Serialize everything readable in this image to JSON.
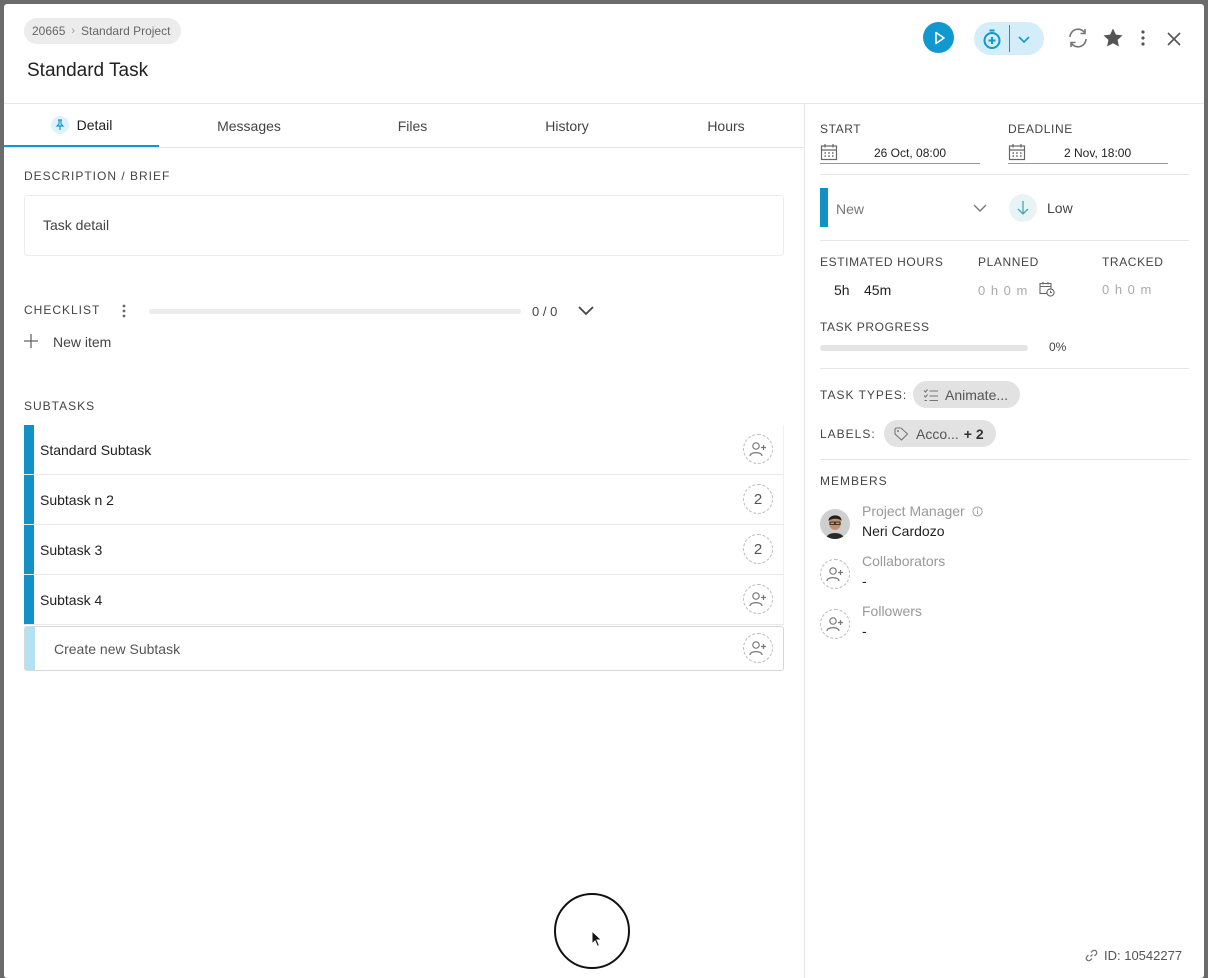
{
  "breadcrumb": {
    "project_id": "20665",
    "project_name": "Standard Project"
  },
  "task": {
    "title": "Standard Task",
    "id_label": "ID: 10542277"
  },
  "tabs": [
    {
      "label": "Detail",
      "active": true
    },
    {
      "label": "Messages"
    },
    {
      "label": "Files"
    },
    {
      "label": "History"
    },
    {
      "label": "Hours"
    }
  ],
  "description": {
    "label": "DESCRIPTION / BRIEF",
    "text": "Task detail"
  },
  "checklist": {
    "label": "CHECKLIST",
    "count": "0 / 0",
    "progress": 0,
    "new_item": "New item"
  },
  "subtasks": {
    "label": "SUBTASKS",
    "items": [
      {
        "name": "Standard Subtask",
        "assignees": ""
      },
      {
        "name": "Subtask n 2",
        "assignees": "2"
      },
      {
        "name": "Subtask 3",
        "assignees": "2"
      },
      {
        "name": "Subtask 4",
        "assignees": ""
      }
    ],
    "create_placeholder": "Create new Subtask"
  },
  "dates": {
    "start_label": "START",
    "start_value": "26 Oct, 08:00",
    "deadline_label": "DEADLINE",
    "deadline_value": "2 Nov, 18:00"
  },
  "status": {
    "value": "New",
    "color": "#1191c6"
  },
  "priority": {
    "value": "Low"
  },
  "hours": {
    "estimated_label": "ESTIMATED HOURS",
    "estimated_h": "5h",
    "estimated_m": "45m",
    "planned_label": "PLANNED",
    "planned_value": "0 h 0 m",
    "tracked_label": "TRACKED",
    "tracked_value": "0 h 0 m"
  },
  "progress": {
    "label": "TASK PROGRESS",
    "value": 0,
    "value_label": "0%"
  },
  "task_types": {
    "label": "TASK TYPES:",
    "chip": "Animate..."
  },
  "labels": {
    "label": "LABELS:",
    "chip": "Acco...",
    "more": "+ 2"
  },
  "members": {
    "label": "MEMBERS",
    "project_manager_role": "Project Manager",
    "project_manager_name": "Neri Cardozo",
    "collaborators_role": "Collaborators",
    "collaborators_value": "-",
    "followers_role": "Followers",
    "followers_value": "-"
  },
  "colors": {
    "accent": "#1199cf",
    "status_bar": "#1191c6",
    "timer_bg": "#d3eef9"
  }
}
